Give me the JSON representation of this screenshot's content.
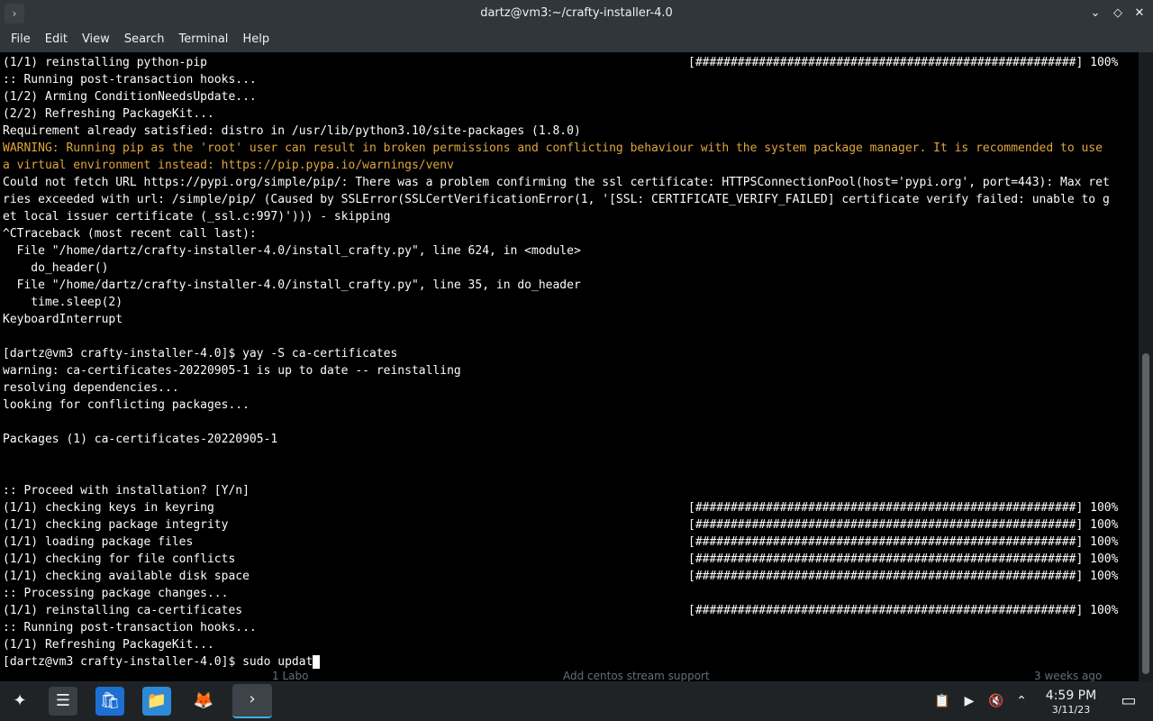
{
  "window": {
    "title": "dartz@vm3:~/crafty-installer-4.0",
    "app_icon_glyph": "›",
    "minimize_glyph": "⌄",
    "maximize_glyph": "◇",
    "close_glyph": "✕"
  },
  "menu": [
    "File",
    "Edit",
    "View",
    "Search",
    "Terminal",
    "Help"
  ],
  "terminal": {
    "lines": [
      "(1/1) reinstalling python-pip",
      ":: Running post-transaction hooks...",
      "(1/2) Arming ConditionNeedsUpdate...",
      "(2/2) Refreshing PackageKit...",
      "Requirement already satisfied: distro in /usr/lib/python3.10/site-packages (1.8.0)",
      "WARNING: Running pip as the 'root' user can result in broken permissions and conflicting behaviour with the system package manager. It is recommended to use",
      "a virtual environment instead: https://pip.pypa.io/warnings/venv",
      "Could not fetch URL https://pypi.org/simple/pip/: There was a problem confirming the ssl certificate: HTTPSConnectionPool(host='pypi.org', port=443): Max ret",
      "ries exceeded with url: /simple/pip/ (Caused by SSLError(SSLCertVerificationError(1, '[SSL: CERTIFICATE_VERIFY_FAILED] certificate verify failed: unable to g",
      "et local issuer certificate (_ssl.c:997)'))) - skipping",
      "^CTraceback (most recent call last):",
      "  File \"/home/dartz/crafty-installer-4.0/install_crafty.py\", line 624, in <module>",
      "    do_header()",
      "  File \"/home/dartz/crafty-installer-4.0/install_crafty.py\", line 35, in do_header",
      "    time.sleep(2)",
      "KeyboardInterrupt",
      "",
      "[dartz@vm3 crafty-installer-4.0]$ yay -S ca-certificates",
      "warning: ca-certificates-20220905-1 is up to date -- reinstalling",
      "resolving dependencies...",
      "looking for conflicting packages...",
      "",
      "Packages (1) ca-certificates-20220905-1",
      "",
      "",
      ":: Proceed with installation? [Y/n]",
      "(1/1) checking keys in keyring",
      "(1/1) checking package integrity",
      "(1/1) loading package files",
      "(1/1) checking for file conflicts",
      "(1/1) checking available disk space",
      ":: Processing package changes...",
      "(1/1) reinstalling ca-certificates",
      ":: Running post-transaction hooks...",
      "(1/1) Refreshing PackageKit...",
      "[dartz@vm3 crafty-installer-4.0]$ sudo updat"
    ],
    "warning_lines": [
      5,
      6
    ],
    "progress_bar": "[######################################################] 100%",
    "progress_lines": [
      0,
      26,
      27,
      28,
      29,
      30,
      32
    ],
    "prompt_line": 35
  },
  "background_window": {
    "text_1": "1 Labo",
    "text_2": "Add centos stream support",
    "text_3": "3 weeks ago"
  },
  "taskbar": {
    "launcher_glyph": "✦",
    "settings_glyph": "☰",
    "store_glyph": "🛍",
    "files_glyph": "📁",
    "browser_glyph": "🦊",
    "terminal_glyph": "›",
    "clipboard_glyph": "📋",
    "media_glyph": "▶",
    "volume_glyph": "🔇",
    "expand_glyph": "⌃",
    "desktop_glyph": "▭",
    "time": "4:59 PM",
    "date": "3/11/23"
  }
}
